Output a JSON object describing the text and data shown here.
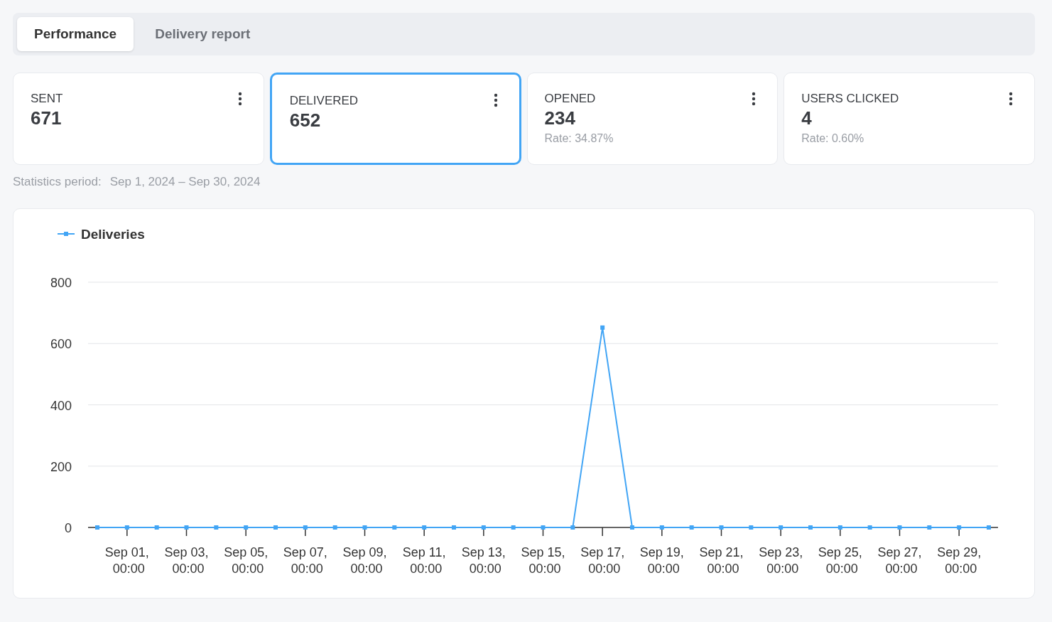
{
  "tabs": [
    {
      "label": "Performance",
      "selected": true
    },
    {
      "label": "Delivery report",
      "selected": false
    }
  ],
  "cards": [
    {
      "label": "SENT",
      "value": "671",
      "selected": false
    },
    {
      "label": "DELIVERED",
      "value": "652",
      "selected": true
    },
    {
      "label": "OPENED",
      "value": "234",
      "rate": "Rate: 34.87%",
      "selected": false
    },
    {
      "label": "USERS CLICKED",
      "value": "4",
      "rate": "Rate: 0.60%",
      "selected": false
    }
  ],
  "statistics_period": {
    "label": "Statistics period:",
    "value": "Sep 1, 2024 – Sep 30, 2024"
  },
  "chart": {
    "chart_data": {
      "type": "line",
      "grid": true,
      "series": [
        {
          "name": "Deliveries",
          "color": "#42a5f5",
          "marker": "square",
          "values": [
            0,
            0,
            0,
            0,
            0,
            0,
            0,
            0,
            0,
            0,
            0,
            0,
            0,
            0,
            0,
            0,
            0,
            652,
            0,
            0,
            0,
            0,
            0,
            0,
            0,
            0,
            0,
            0,
            0,
            0,
            0
          ]
        }
      ],
      "categories": [
        null,
        "Sep 01, 00:00",
        null,
        "Sep 03, 00:00",
        null,
        "Sep 05, 00:00",
        null,
        "Sep 07, 00:00",
        null,
        "Sep 09, 00:00",
        null,
        "Sep 11, 00:00",
        null,
        "Sep 13, 00:00",
        null,
        "Sep 15, 00:00",
        null,
        "Sep 17, 00:00",
        null,
        "Sep 19, 00:00",
        null,
        "Sep 21, 00:00",
        null,
        "Sep 23, 00:00",
        null,
        "Sep 25, 00:00",
        null,
        "Sep 27, 00:00",
        null,
        "Sep 29, 00:00",
        null
      ],
      "ylim": [
        0,
        800
      ],
      "yticks": [
        0,
        200,
        400,
        600,
        800
      ]
    }
  }
}
